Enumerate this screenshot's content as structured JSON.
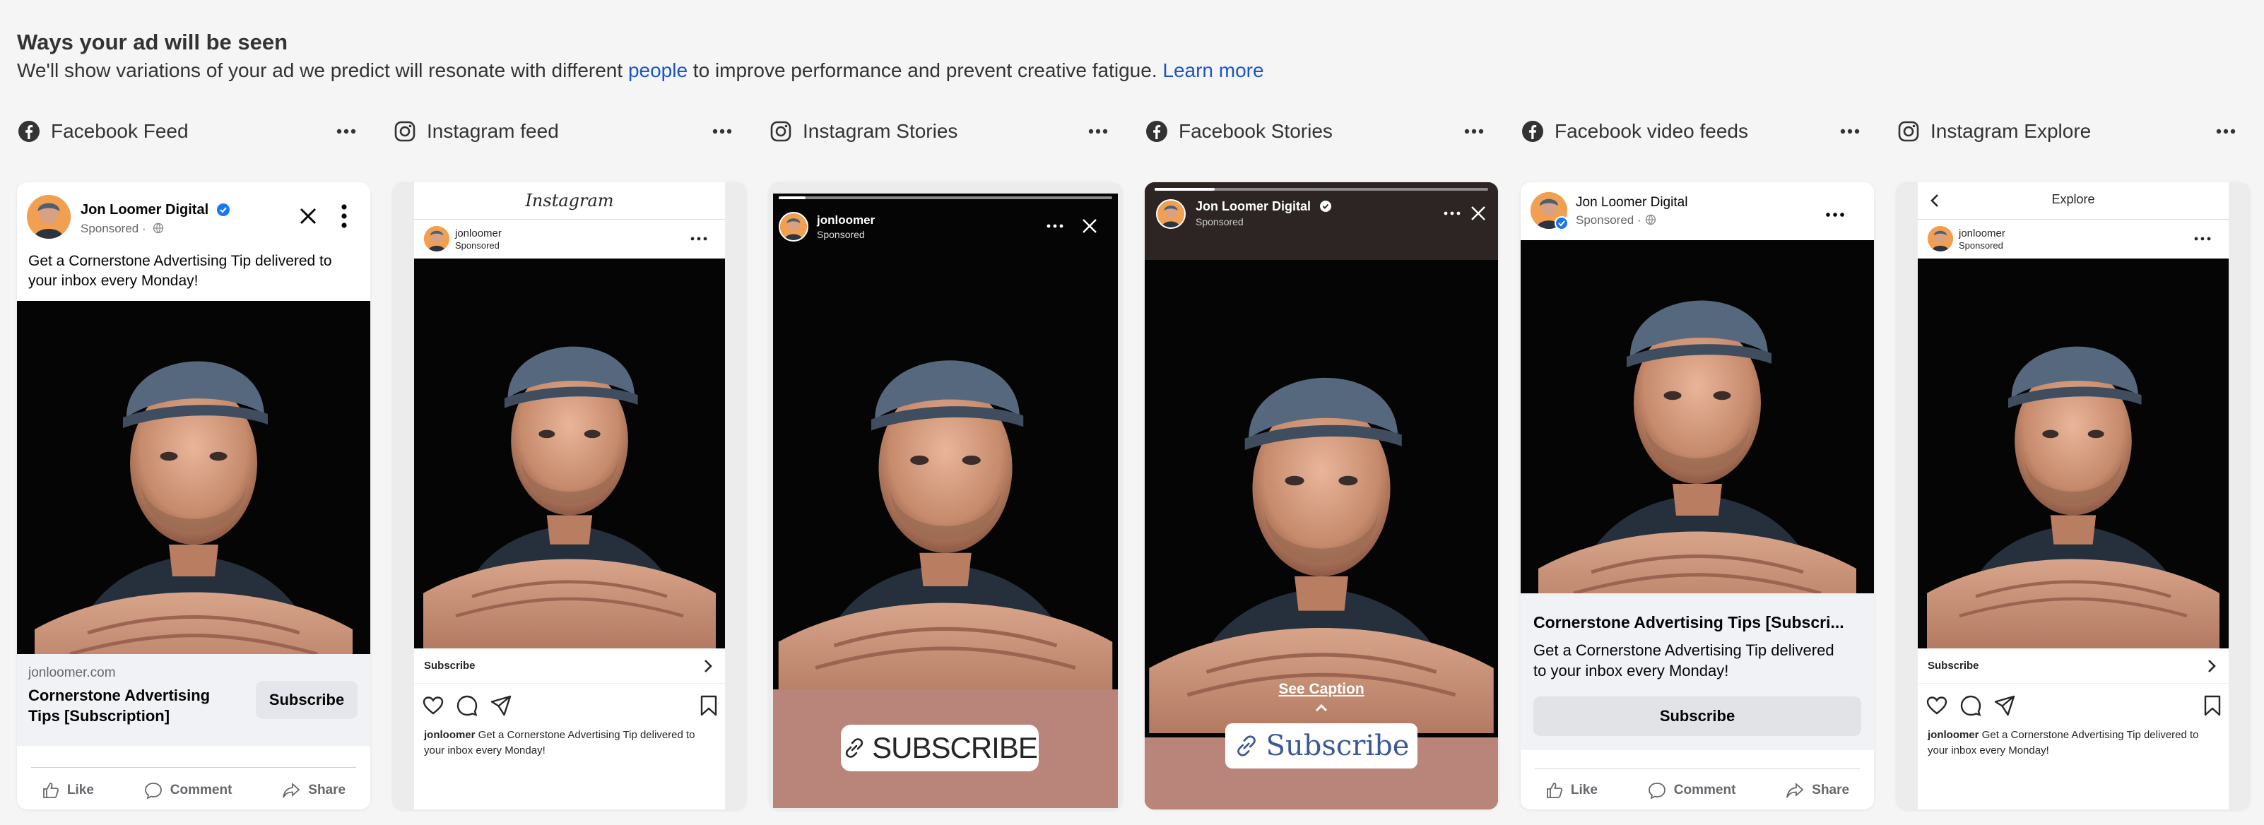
{
  "header": {
    "title": "Ways your ad will be seen",
    "desc_before": "We'll show variations of your ad we predict will resonate with different ",
    "people_link": "people",
    "desc_after": " to improve performance and prevent creative fatigue. ",
    "learn_more": "Learn more"
  },
  "colors": {
    "facebook_blue": "#1877f2",
    "link_blue": "#1a56c5",
    "story_footer": "#b9847a"
  },
  "placements": [
    {
      "platform": "facebook",
      "title": "Facebook Feed",
      "page_name": "Jon Loomer Digital",
      "sponsored": "Sponsored · ",
      "primary_text": "Get a Cornerstone Advertising Tip delivered to your inbox every Monday!",
      "domain": "jonloomer.com",
      "headline": "Cornerstone Advertising Tips [Subscription]",
      "cta": "Subscribe",
      "actions": {
        "like": "Like",
        "comment": "Comment",
        "share": "Share"
      }
    },
    {
      "platform": "instagram",
      "title": "Instagram feed",
      "app_logo": "Instagram",
      "username": "jonloomer",
      "sponsored": "Sponsored",
      "cta": "Subscribe",
      "caption_user": "jonloomer",
      "caption": " Get a Cornerstone Advertising Tip delivered to your inbox every Monday!"
    },
    {
      "platform": "instagram",
      "title": "Instagram Stories",
      "username": "jonloomer",
      "sponsored": "Sponsored",
      "cta": "SUBSCRIBE"
    },
    {
      "platform": "facebook",
      "title": "Facebook Stories",
      "page_name": "Jon Loomer Digital",
      "sponsored": "Sponsored",
      "see_caption": "See Caption",
      "cta": "Subscribe"
    },
    {
      "platform": "facebook",
      "title": "Facebook video feeds",
      "page_name": "Jon Loomer Digital",
      "sponsored": "Sponsored · ",
      "headline": "Cornerstone Advertising Tips [Subscri...",
      "primary_text": "Get a Cornerstone Advertising Tip delivered to your inbox every Monday!",
      "cta": "Subscribe",
      "actions": {
        "like": "Like",
        "comment": "Comment",
        "share": "Share"
      }
    },
    {
      "platform": "instagram",
      "title": "Instagram Explore",
      "explore_title": "Explore",
      "username": "jonloomer",
      "sponsored": "Sponsored",
      "cta": "Subscribe",
      "caption_user": "jonloomer",
      "caption": " Get a Cornerstone Advertising Tip delivered to your inbox every Monday!"
    }
  ]
}
